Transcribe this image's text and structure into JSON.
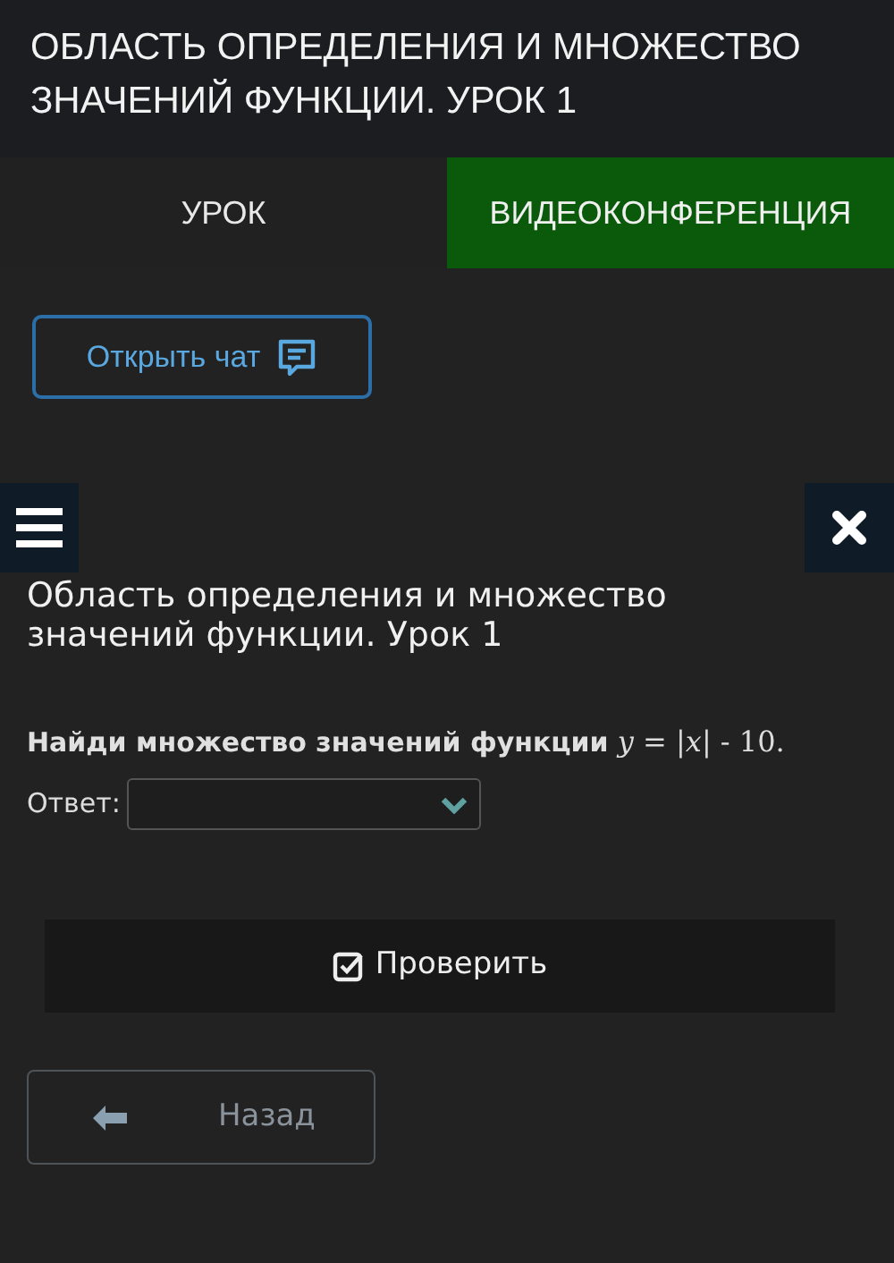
{
  "header": {
    "title": "ОБЛАСТЬ ОПРЕДЕЛЕНИЯ И МНОЖЕСТВО ЗНАЧЕНИЙ ФУНКЦИИ. УРОК 1"
  },
  "tabs": [
    {
      "label": "УРОК",
      "selected": false
    },
    {
      "label": "ВИДЕОКОНФЕРЕНЦИЯ",
      "selected": true
    }
  ],
  "chat_button": {
    "label": "Открыть чат"
  },
  "lesson": {
    "heading": "Область определения и множество значений функции. Урок 1",
    "question": "**Найди множество значений функции** *y* = |*x*| - 10.",
    "answer_label": "Ответ:"
  },
  "check_button": {
    "label": "Проверить"
  },
  "back_button": {
    "label": "Назад"
  }
}
